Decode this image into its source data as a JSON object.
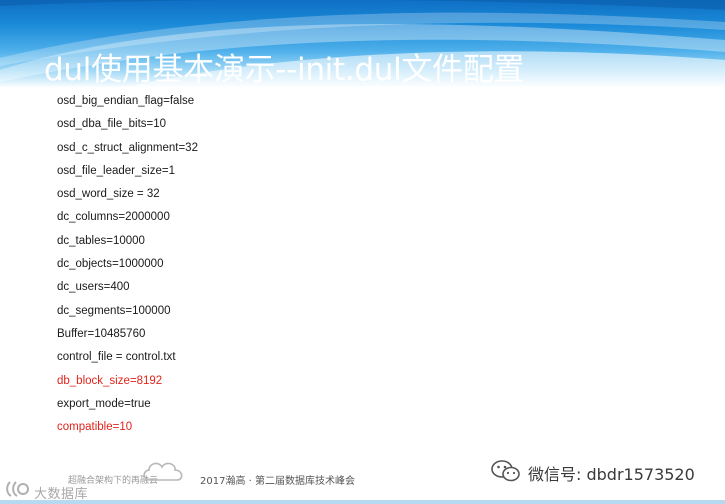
{
  "slide": {
    "title": "dul使用基本演示--init.dul文件配置"
  },
  "config_lines": [
    {
      "text": "osd_big_endian_flag=false",
      "highlight": false
    },
    {
      "text": "osd_dba_file_bits=10",
      "highlight": false
    },
    {
      "text": "osd_c_struct_alignment=32",
      "highlight": false
    },
    {
      "text": "osd_file_leader_size=1",
      "highlight": false
    },
    {
      "text": "osd_word_size = 32",
      "highlight": false
    },
    {
      "text": "dc_columns=2000000",
      "highlight": false
    },
    {
      "text": "dc_tables=10000",
      "highlight": false
    },
    {
      "text": "dc_objects=1000000",
      "highlight": false
    },
    {
      "text": "dc_users=400",
      "highlight": false
    },
    {
      "text": "dc_segments=100000",
      "highlight": false
    },
    {
      "text": "Buffer=10485760",
      "highlight": false
    },
    {
      "text": "control_file = control.txt",
      "highlight": false
    },
    {
      "text": "db_block_size=8192",
      "highlight": true
    },
    {
      "text": "export_mode=true",
      "highlight": false
    },
    {
      "text": "compatible=10",
      "highlight": true
    }
  ],
  "footer": {
    "logo_text": "大数据库",
    "tagline": "超融合架构下的再融云",
    "event": "2017瀚高 · 第二届数据库技术峰会",
    "wechat": "微信号: dbdr1573520",
    "icons": [
      "cloud-icon",
      "wechat-icon",
      "brand-logo-icon"
    ]
  },
  "colors": {
    "banner_dark": "#0f6fc4",
    "banner_light": "#a9dcf7",
    "highlight_text": "#e0241b",
    "body_text": "#1a1a1a"
  }
}
